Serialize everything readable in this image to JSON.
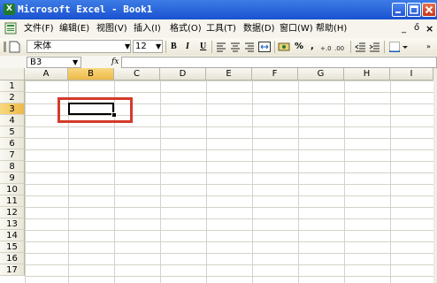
{
  "window": {
    "title": "Microsoft Excel - Book1",
    "app_icon": "excel-icon"
  },
  "menu": {
    "items": [
      "文件(F)",
      "编辑(E)",
      "视图(V)",
      "插入(I)",
      "格式(O)",
      "工具(T)",
      "数据(D)",
      "窗口(W)",
      "帮助(H)"
    ],
    "doc_controls": {
      "minimize": "_",
      "restore": "ő",
      "close": "×"
    }
  },
  "toolbar": {
    "font_name": "宋体",
    "font_size": "12",
    "bold": "B",
    "italic": "I",
    "underline": "U",
    "percent": "%",
    "comma": ","
  },
  "formula_bar": {
    "name_box": "B3",
    "fx": "fx",
    "formula": ""
  },
  "sheet": {
    "columns": [
      "A",
      "B",
      "C",
      "D",
      "E",
      "F",
      "G",
      "H",
      "I"
    ],
    "rows": [
      "1",
      "2",
      "3",
      "4",
      "5",
      "6",
      "7",
      "8",
      "9",
      "10",
      "11",
      "12",
      "13",
      "14",
      "15",
      "16",
      "17"
    ],
    "selected_column": "B",
    "selected_row": "3",
    "active_cell": "B3"
  },
  "colors": {
    "title_bar": "#2a61d8",
    "highlight": "#d43a2a",
    "selected_header": "#f3c25a"
  }
}
